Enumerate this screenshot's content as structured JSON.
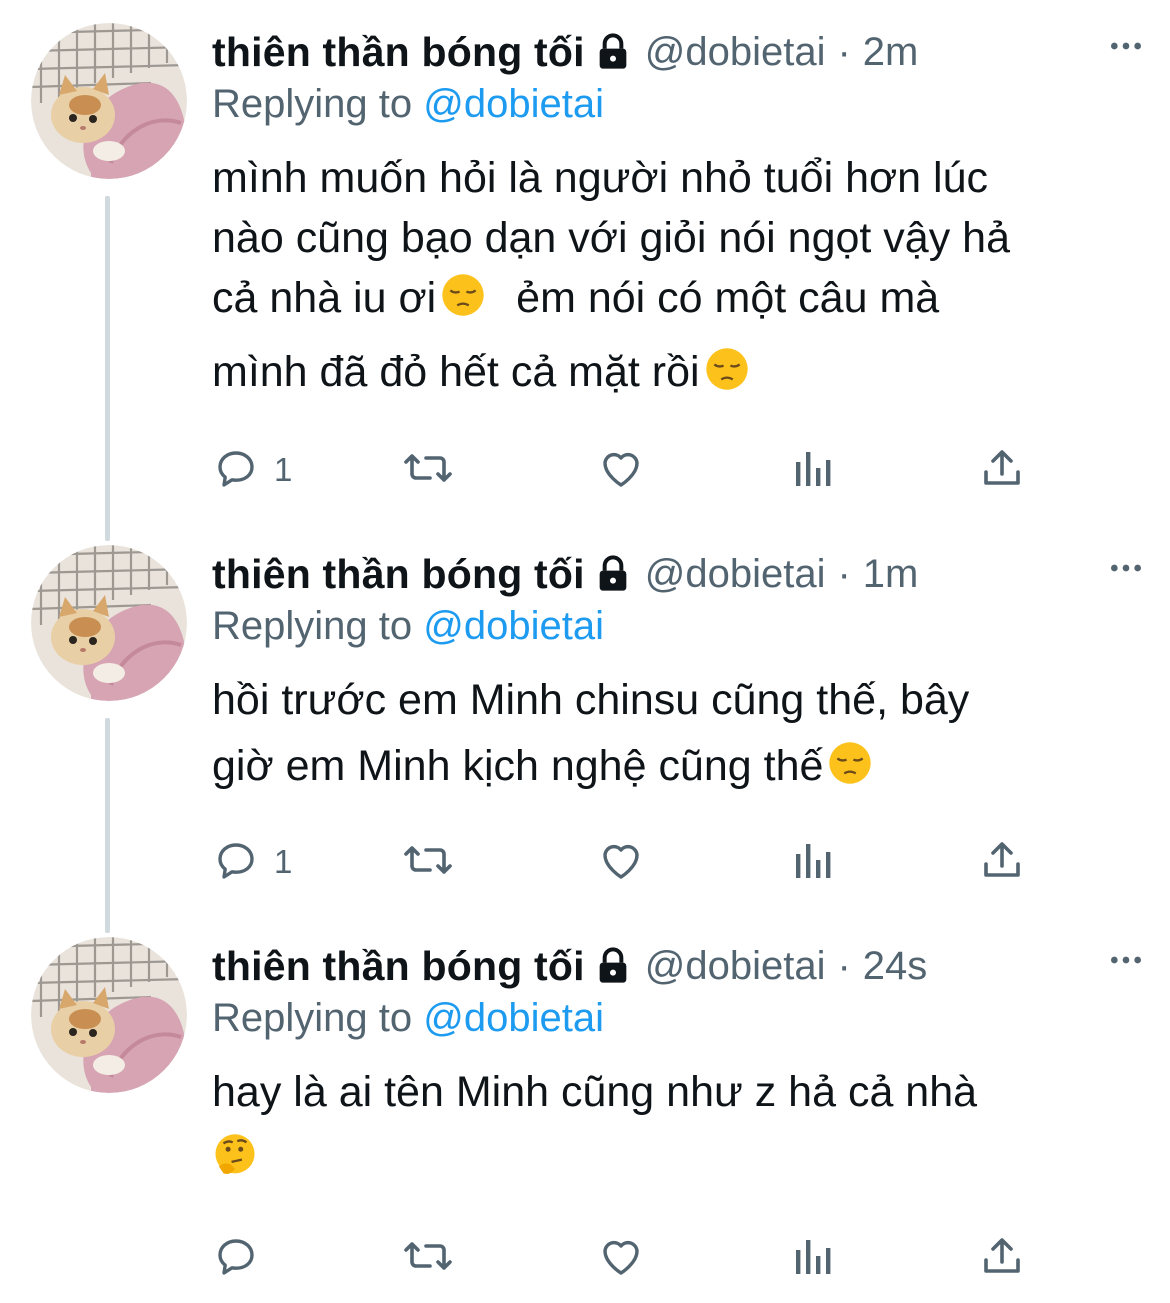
{
  "tweets": [
    {
      "name": "thiên thần bóng tối",
      "handle": "@dobietai",
      "dot": "·",
      "time": "2m",
      "replying_prefix": "Replying to",
      "replying_to": "@dobietai",
      "lines": [
        "mình muốn hỏi là người nhỏ tuổi hơn lúc",
        "nào cũng bạo dạn với giỏi nói ngọt vậy hả",
        "cả nhà iu ơi",
        "ẻm nói có một câu mà",
        "mình đã đỏ hết cả mặt rồi"
      ],
      "reply_count": "1",
      "emoji": "pensive-face-emoji"
    },
    {
      "name": "thiên thần bóng tối",
      "handle": "@dobietai",
      "dot": "·",
      "time": "1m",
      "replying_prefix": "Replying to",
      "replying_to": "@dobietai",
      "lines": [
        "hồi trước em Minh chinsu cũng thế, bây",
        "giờ em Minh kịch nghệ cũng thế"
      ],
      "reply_count": "1",
      "emoji": "pensive-face-emoji"
    },
    {
      "name": "thiên thần bóng tối",
      "handle": "@dobietai",
      "dot": "·",
      "time": "24s",
      "replying_prefix": "Replying to",
      "replying_to": "@dobietai",
      "lines": [
        "hay là ai tên Minh cũng như z hả cả nhà"
      ],
      "reply_count": "",
      "emoji": "thinking-face-emoji"
    }
  ],
  "icons": {
    "lock": "lock-icon",
    "more": "more-options-icon",
    "reply": "reply-icon",
    "retweet": "retweet-icon",
    "like": "like-icon",
    "analytics": "analytics-icon",
    "share": "share-icon"
  },
  "colors": {
    "text": "#0f1419",
    "secondary": "#536471",
    "mention": "#1d9bf0",
    "thread_line": "#cfd9de"
  }
}
